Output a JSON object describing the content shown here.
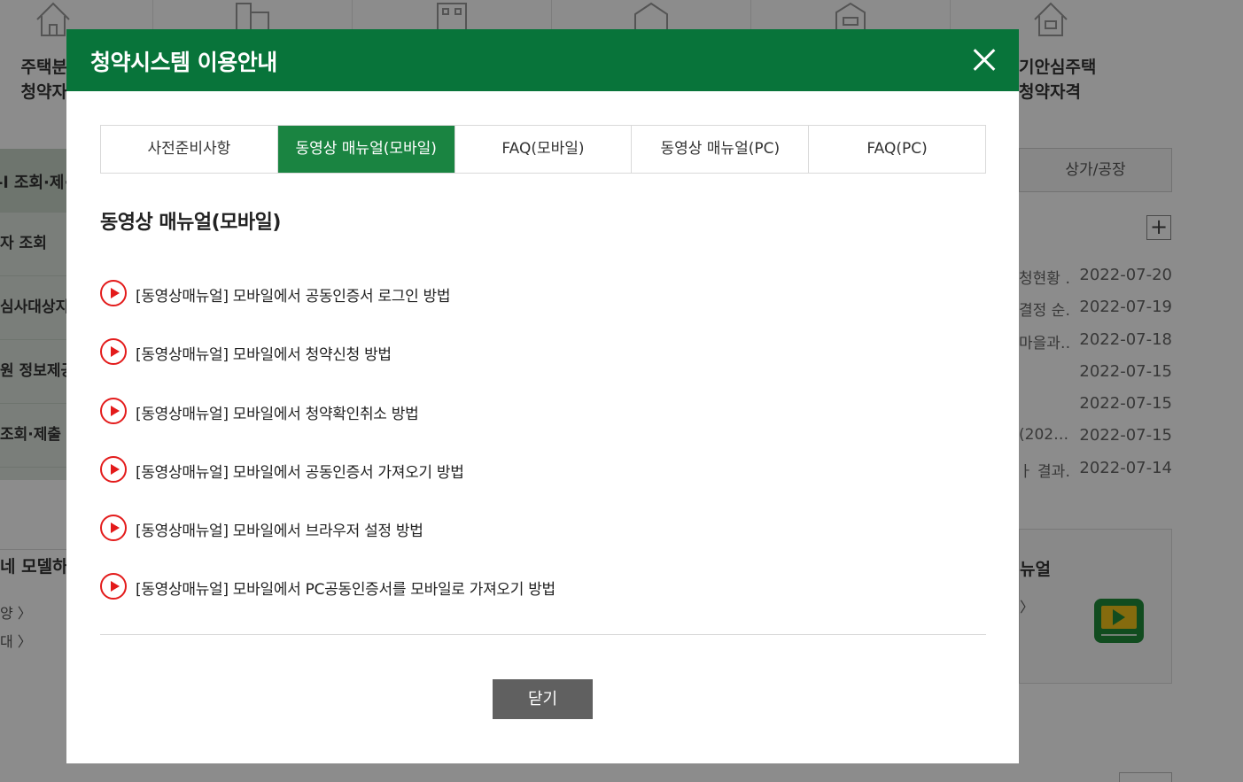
{
  "background": {
    "categories": [
      {
        "label": "주택분\n청약자",
        "icon": "house-icon"
      },
      {
        "label": "",
        "icon": "building-icon"
      },
      {
        "label": "",
        "icon": "apartment-icon"
      },
      {
        "label": "",
        "icon": "townhouse-icon"
      },
      {
        "label": "",
        "icon": "villa-icon"
      },
      {
        "label": "기안심주택\n청약자격",
        "icon": "home-icon"
      }
    ],
    "left_menu": [
      "-l 조회·제·",
      "자 조회",
      "심사대상지",
      "원 정보제공",
      "조회·제출"
    ],
    "left_sub": {
      "title": "네 모델하우",
      "link1": "양 〉",
      "link2": "대 〉"
    },
    "right_tab": "상가/공장",
    "news": [
      {
        "title": "청현황 …",
        "date": "2022-07-20"
      },
      {
        "title": "결정 순…",
        "date": "2022-07-19"
      },
      {
        "title": "마을과…",
        "date": "2022-07-18"
      },
      {
        "title": "",
        "date": "2022-07-15"
      },
      {
        "title": "",
        "date": "2022-07-15"
      },
      {
        "title": "(202…",
        "date": "2022-07-15"
      },
      {
        "title": "ㅏ 결과…",
        "date": "2022-07-14"
      }
    ],
    "right_card": {
      "title": "뉴얼",
      "arrow": "〉"
    }
  },
  "modal": {
    "title": "청약시스템 이용안내",
    "close_icon": "close-icon",
    "tabs": [
      {
        "label": "사전준비사항",
        "active": false
      },
      {
        "label": "동영상 매뉴얼(모바일)",
        "active": true
      },
      {
        "label": "FAQ(모바일)",
        "active": false
      },
      {
        "label": "동영상 매뉴얼(PC)",
        "active": false
      },
      {
        "label": "FAQ(PC)",
        "active": false
      }
    ],
    "section_title": "동영상 매뉴얼(모바일)",
    "videos": [
      "[동영상매뉴얼] 모바일에서 공동인증서 로그인 방법",
      "[동영상매뉴얼] 모바일에서 청약신청 방법",
      "[동영상매뉴얼] 모바일에서 청약확인취소 방법",
      "[동영상매뉴얼] 모바일에서 공동인증서 가져오기 방법",
      "[동영상매뉴얼] 모바일에서 브라우저 설정 방법",
      "[동영상매뉴얼] 모바일에서 PC공동인증서를 모바일로 가져오기 방법"
    ],
    "close_button": "닫기"
  },
  "colors": {
    "header_green": "#08743a",
    "active_tab_green": "#1a8441",
    "play_red": "#e31b1b",
    "close_button_gray": "#606060"
  }
}
